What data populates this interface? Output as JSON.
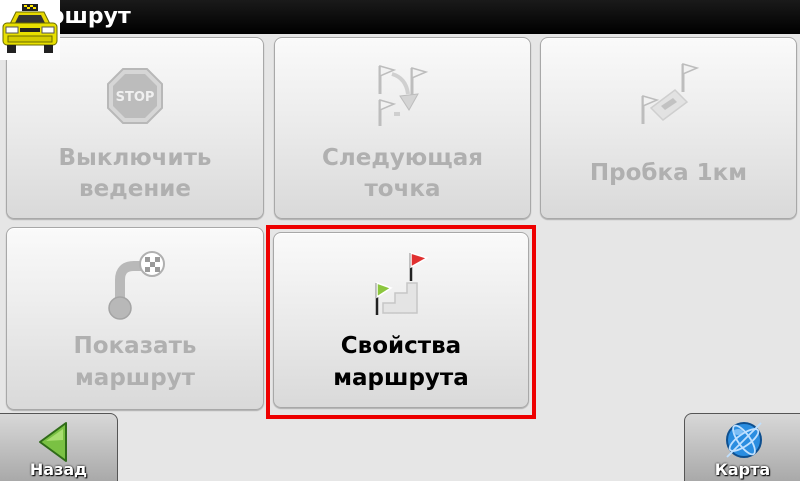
{
  "header": {
    "title": "Маршрут"
  },
  "tiles": [
    {
      "line1": "Выключить",
      "line2": "ведение",
      "icon": "stop-sign-icon",
      "stop_text": "STOP",
      "enabled": false
    },
    {
      "line1": "Следующая",
      "line2": "точка",
      "icon": "next-waypoint-icon",
      "enabled": false
    },
    {
      "line1": "Пробка 1км",
      "icon": "traffic-jam-icon",
      "enabled": false
    },
    {
      "line1": "Показать",
      "line2": "маршрут",
      "icon": "show-route-icon",
      "enabled": false
    },
    {
      "line1": "Свойства",
      "line2": "маршрута",
      "icon": "route-properties-icon",
      "enabled": true,
      "selected": true
    }
  ],
  "footer": {
    "back_label": "Назад",
    "map_label": "Карта"
  },
  "colors": {
    "selection": "#ee0000",
    "start_flag": "#8cc63e",
    "end_flag": "#e03030",
    "title_bar": "#000000",
    "map_globe": "#2a8de0"
  }
}
